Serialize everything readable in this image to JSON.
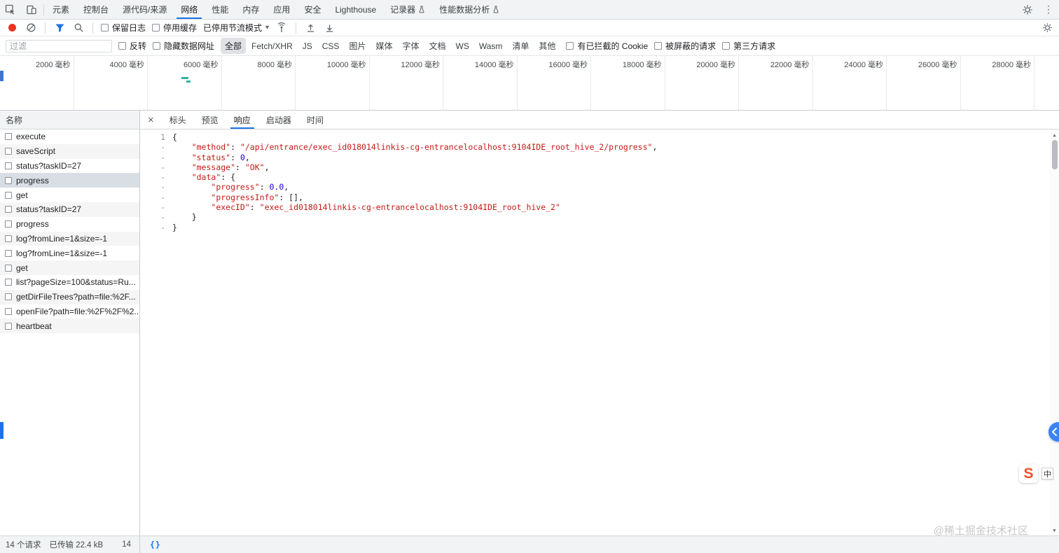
{
  "top_bar": {
    "tabs": [
      {
        "label": "元素",
        "active": false,
        "beaker": false
      },
      {
        "label": "控制台",
        "active": false,
        "beaker": false
      },
      {
        "label": "源代码/来源",
        "active": false,
        "beaker": false
      },
      {
        "label": "网络",
        "active": true,
        "beaker": false
      },
      {
        "label": "性能",
        "active": false,
        "beaker": false
      },
      {
        "label": "内存",
        "active": false,
        "beaker": false
      },
      {
        "label": "应用",
        "active": false,
        "beaker": false
      },
      {
        "label": "安全",
        "active": false,
        "beaker": false
      },
      {
        "label": "Lighthouse",
        "active": false,
        "beaker": false
      },
      {
        "label": "记录器",
        "active": false,
        "beaker": true
      },
      {
        "label": "性能数据分析",
        "active": false,
        "beaker": true
      }
    ],
    "more_glyph": "⋮"
  },
  "toolbar": {
    "preserve_log_label": "保留日志",
    "disable_cache_label": "停用缓存",
    "throttling_value": "已停用节流模式",
    "caret_glyph": "▾"
  },
  "filter_bar": {
    "filter_placeholder": "过滤",
    "invert_label": "反转",
    "hide_data_urls_label": "隐藏数据网址",
    "type_chips": [
      {
        "label": "全部",
        "active": true
      },
      {
        "label": "Fetch/XHR",
        "active": false
      },
      {
        "label": "JS",
        "active": false
      },
      {
        "label": "CSS",
        "active": false
      },
      {
        "label": "图片",
        "active": false
      },
      {
        "label": "媒体",
        "active": false
      },
      {
        "label": "字体",
        "active": false
      },
      {
        "label": "文档",
        "active": false
      },
      {
        "label": "WS",
        "active": false
      },
      {
        "label": "Wasm",
        "active": false
      },
      {
        "label": "清单",
        "active": false
      },
      {
        "label": "其他",
        "active": false
      }
    ],
    "blocked_cookies_label": "有已拦截的 Cookie",
    "blocked_requests_label": "被屏蔽的请求",
    "third_party_label": "第三方请求"
  },
  "timeline": {
    "labels": [
      "2000 毫秒",
      "4000 毫秒",
      "6000 毫秒",
      "8000 毫秒",
      "10000 毫秒",
      "12000 毫秒",
      "14000 毫秒",
      "16000 毫秒",
      "18000 毫秒",
      "20000 毫秒",
      "22000 毫秒",
      "24000 毫秒",
      "26000 毫秒",
      "28000 毫秒"
    ]
  },
  "requests": {
    "name_header": "名称",
    "rows": [
      {
        "label": "execute",
        "selected": false
      },
      {
        "label": "saveScript",
        "selected": false
      },
      {
        "label": "status?taskID=27",
        "selected": false
      },
      {
        "label": "progress",
        "selected": true
      },
      {
        "label": "get",
        "selected": false
      },
      {
        "label": "status?taskID=27",
        "selected": false
      },
      {
        "label": "progress",
        "selected": false
      },
      {
        "label": "log?fromLine=1&size=-1",
        "selected": false
      },
      {
        "label": "log?fromLine=1&size=-1",
        "selected": false
      },
      {
        "label": "get",
        "selected": false
      },
      {
        "label": "list?pageSize=100&status=Ru...",
        "selected": false
      },
      {
        "label": "getDirFileTrees?path=file:%2F...",
        "selected": false
      },
      {
        "label": "openFile?path=file:%2F%2F%2...",
        "selected": false
      },
      {
        "label": "heartbeat",
        "selected": false
      }
    ]
  },
  "detail": {
    "close_glyph": "×",
    "tabs": [
      {
        "label": "标头",
        "active": false
      },
      {
        "label": "预览",
        "active": false
      },
      {
        "label": "响应",
        "active": true
      },
      {
        "label": "启动器",
        "active": false
      },
      {
        "label": "时间",
        "active": false
      }
    ]
  },
  "response": {
    "lines": [
      {
        "gutter": "1",
        "segments": [
          {
            "t": "{",
            "c": "p"
          }
        ]
      },
      {
        "gutter": "-",
        "segments": [
          {
            "t": "    ",
            "c": "p"
          },
          {
            "t": "\"method\"",
            "c": "s"
          },
          {
            "t": ": ",
            "c": "p"
          },
          {
            "t": "\"/api/entrance/exec_id018014linkis-cg-entrancelocalhost:9104IDE_root_hive_2/progress\"",
            "c": "s"
          },
          {
            "t": ",",
            "c": "p"
          }
        ]
      },
      {
        "gutter": "-",
        "segments": [
          {
            "t": "    ",
            "c": "p"
          },
          {
            "t": "\"status\"",
            "c": "s"
          },
          {
            "t": ": ",
            "c": "p"
          },
          {
            "t": "0",
            "c": "n"
          },
          {
            "t": ",",
            "c": "p"
          }
        ]
      },
      {
        "gutter": "-",
        "segments": [
          {
            "t": "    ",
            "c": "p"
          },
          {
            "t": "\"message\"",
            "c": "s"
          },
          {
            "t": ": ",
            "c": "p"
          },
          {
            "t": "\"OK\"",
            "c": "s"
          },
          {
            "t": ",",
            "c": "p"
          }
        ]
      },
      {
        "gutter": "-",
        "segments": [
          {
            "t": "    ",
            "c": "p"
          },
          {
            "t": "\"data\"",
            "c": "s"
          },
          {
            "t": ": {",
            "c": "p"
          }
        ]
      },
      {
        "gutter": "-",
        "segments": [
          {
            "t": "        ",
            "c": "p"
          },
          {
            "t": "\"progress\"",
            "c": "s"
          },
          {
            "t": ": ",
            "c": "p"
          },
          {
            "t": "0.0",
            "c": "n"
          },
          {
            "t": ",",
            "c": "p"
          }
        ]
      },
      {
        "gutter": "-",
        "segments": [
          {
            "t": "        ",
            "c": "p"
          },
          {
            "t": "\"progressInfo\"",
            "c": "s"
          },
          {
            "t": ": [],",
            "c": "p"
          }
        ]
      },
      {
        "gutter": "-",
        "segments": [
          {
            "t": "        ",
            "c": "p"
          },
          {
            "t": "\"execID\"",
            "c": "s"
          },
          {
            "t": ": ",
            "c": "p"
          },
          {
            "t": "\"exec_id018014linkis-cg-entrancelocalhost:9104IDE_root_hive_2\"",
            "c": "s"
          }
        ]
      },
      {
        "gutter": "-",
        "segments": [
          {
            "t": "    }",
            "c": "p"
          }
        ]
      },
      {
        "gutter": "-",
        "segments": [
          {
            "t": "}",
            "c": "p"
          }
        ]
      }
    ],
    "scroll_up_glyph": "▲",
    "scroll_down_glyph": "▼"
  },
  "status_bar": {
    "requests_count": "14 个请求",
    "transferred": "已传输 22.4 kB",
    "extra": "14",
    "format_glyph": "{}"
  },
  "overlay": {
    "watermark": "@稀土掘金技术社区",
    "ime_s": "S",
    "ime_mode": "中"
  }
}
